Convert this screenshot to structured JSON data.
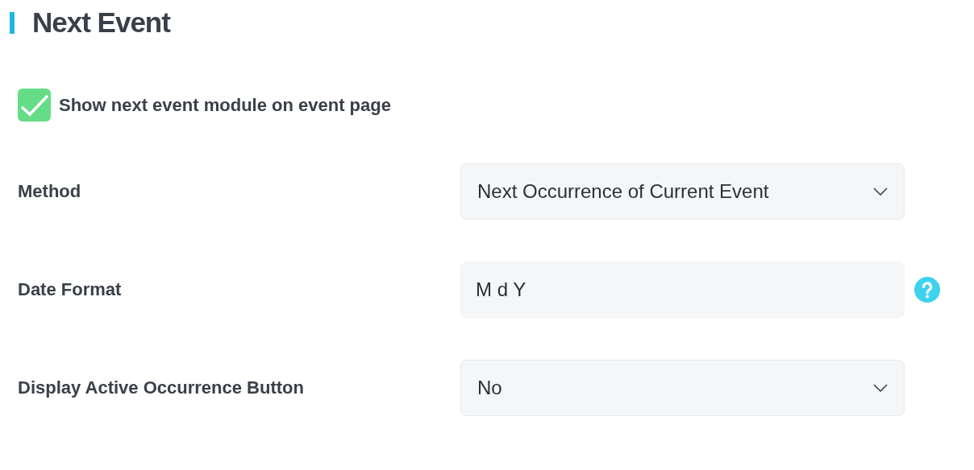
{
  "title": "Next Event",
  "checkbox": {
    "label": "Show next event module on event page",
    "checked": true
  },
  "fields": [
    {
      "label": "Method",
      "kind": "select",
      "value": "Next Occurrence of Current Event",
      "help": false
    },
    {
      "label": "Date Format",
      "kind": "text",
      "value": "M d Y",
      "help": true
    },
    {
      "label": "Display Active Occurrence Button",
      "kind": "select",
      "value": "No",
      "help": false
    }
  ]
}
